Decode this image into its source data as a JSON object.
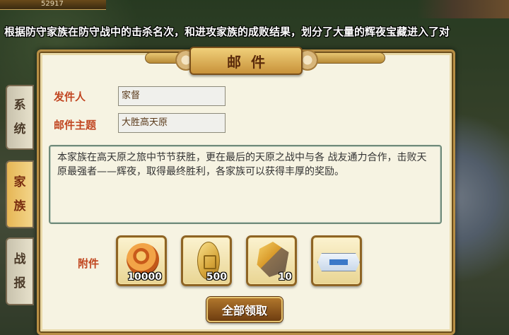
{
  "top_bar": {
    "gold_value": "52917"
  },
  "announcement": "根据防守家族在防守战中的击杀名次，和进攻家族的成败结果，划分了大量的辉夜宝藏进入了对",
  "side_tabs": [
    {
      "label": "系统",
      "active": false
    },
    {
      "label": "家族",
      "active": true
    },
    {
      "label": "战报",
      "active": false
    }
  ],
  "mail": {
    "title": "邮件",
    "sender_label": "发件人",
    "sender_value": "家督",
    "subject_label": "邮件主题",
    "subject_value": "大胜高天原",
    "body": "本家族在高天原之旅中节节获胜，更在最后的天原之战中与各 战友通力合作，击败天原最强者——辉夜，取得最终胜利，各家族可以获得丰厚的奖励。",
    "attachments_label": "附件",
    "attachments": [
      {
        "icon": "copper-coin-icon",
        "count": "10000"
      },
      {
        "icon": "gold-oval-coin-icon",
        "count": "500"
      },
      {
        "icon": "gem-ore-icon",
        "count": "10"
      },
      {
        "icon": "ticket-icon",
        "count": ""
      }
    ],
    "claim_all_button": "全部领取"
  }
}
